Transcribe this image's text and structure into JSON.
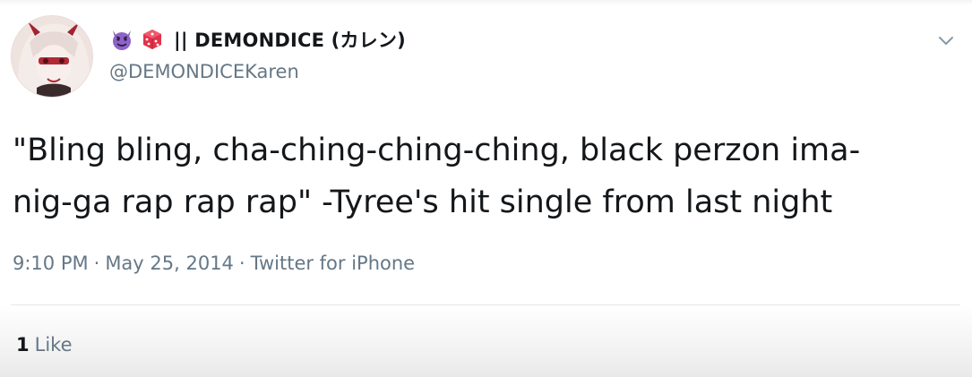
{
  "tweet": {
    "display_name": "|| DEMONDICE (カレン)",
    "handle": "@DEMONDICEKaren",
    "text_line1": "\"Bling bling, cha-ching-ching-ching, black perzon ima-",
    "text_line2": "nig-ga rap rap rap\" -Tyree's hit single from last night",
    "time": "9:10 PM",
    "sep1": "·",
    "date": "May 25, 2014",
    "sep2": "·",
    "source": "Twitter for iPhone",
    "like_count": "1",
    "like_label": "Like"
  },
  "icons": {
    "emoji1": "smiling-imp-icon",
    "emoji2": "game-die-icon",
    "caret": "chevron-down-icon"
  },
  "colors": {
    "text_primary": "#14171a",
    "text_secondary": "#657786",
    "divider": "#e1e8ed",
    "devil": "#8e63c9",
    "die": "#e0334a"
  }
}
